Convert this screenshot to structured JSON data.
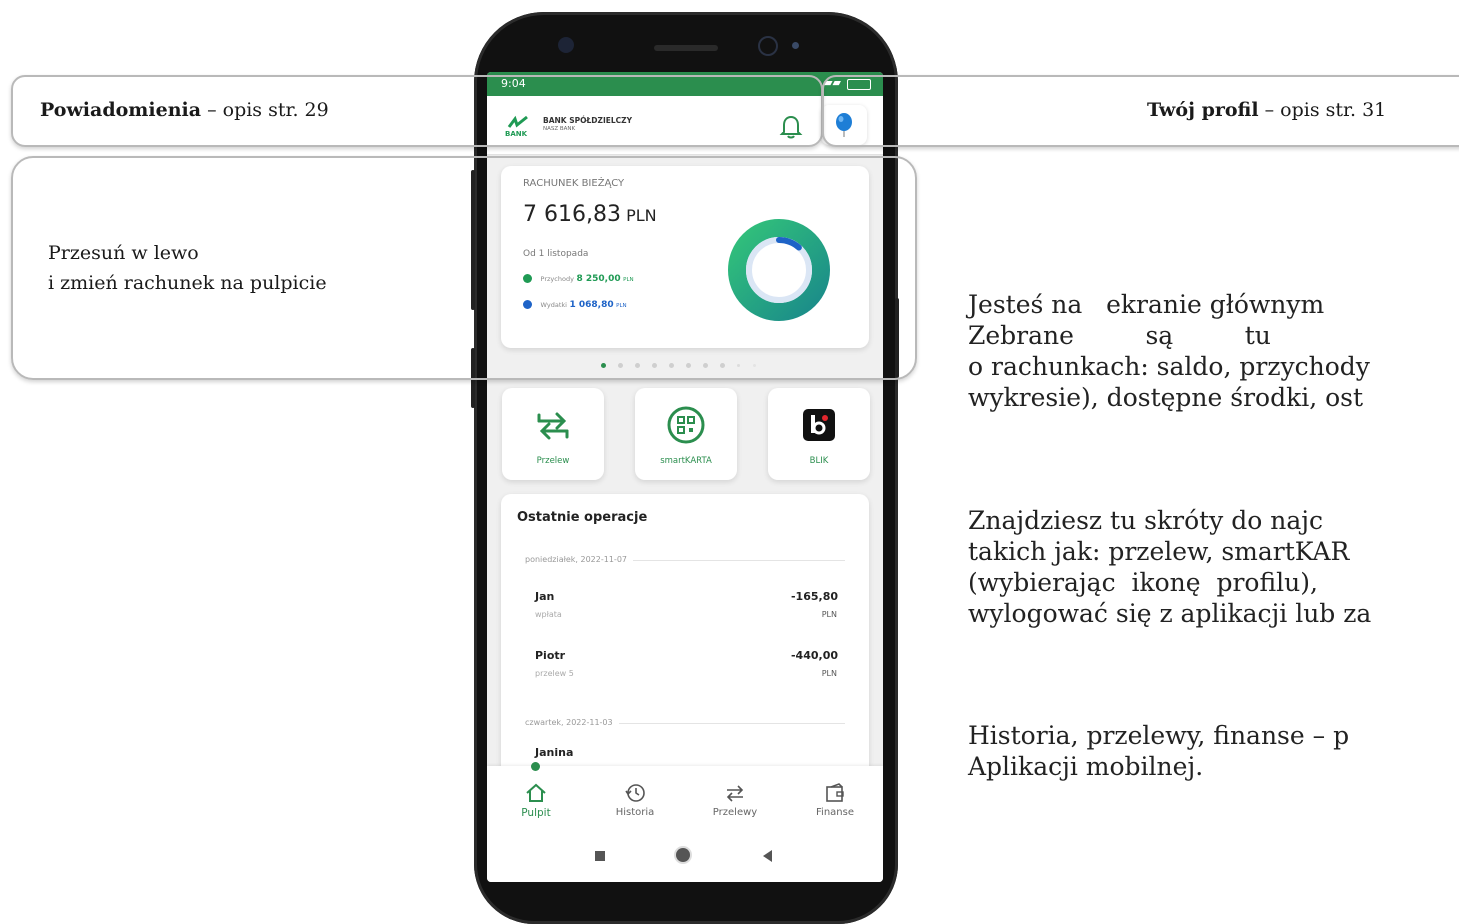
{
  "callouts": {
    "notifications": {
      "bold": "Powiadomienia",
      "rest": " – opis str. 29"
    },
    "profile": {
      "bold": "Twój profil",
      "rest": " – opis str. 31"
    },
    "swipe_line1": "Przesuń w lewo",
    "swipe_line2": "i zmień rachunek na pulpicie"
  },
  "status_bar": {
    "time": "9:04"
  },
  "app": {
    "bank_name": "BANK SPÓŁDZIELCZY",
    "bank_sub": "NASZ BANK",
    "logo_text": "BANK"
  },
  "account": {
    "title": "RACHUNEK BIEŻĄCY",
    "balance": "7 616,83",
    "currency": "PLN",
    "since": "Od 1 listopada",
    "income_label": "Przychody",
    "income_value": "8 250,00",
    "income_currency": "PLN",
    "expense_label": "Wydatki",
    "expense_value": "1 068,80",
    "expense_currency": "PLN",
    "chart_income_share": 0.885,
    "colors": {
      "income": "#1f9a54",
      "expense": "#1e63c7"
    }
  },
  "shortcuts": [
    {
      "label": "Przelew",
      "icon": "transfer-icon"
    },
    {
      "label": "smartKARTA",
      "icon": "qr-icon"
    },
    {
      "label": "BLIK",
      "icon": "blik-icon"
    }
  ],
  "operations": {
    "title": "Ostatnie operacje",
    "groups": [
      {
        "date": "poniedziałek, 2022-11-07",
        "items": [
          {
            "name": "Jan",
            "desc": "wpłata",
            "amount": "-165,80",
            "currency": "PLN"
          },
          {
            "name": "Piotr",
            "desc": "przelew 5",
            "amount": "-440,00",
            "currency": "PLN"
          }
        ]
      },
      {
        "date": "czwartek, 2022-11-03",
        "items": [
          {
            "name": "Janina"
          }
        ]
      }
    ]
  },
  "bottom_nav": [
    {
      "label": "Pulpit",
      "icon": "home-icon",
      "active": true
    },
    {
      "label": "Historia",
      "icon": "history-icon",
      "active": false
    },
    {
      "label": "Przelewy",
      "icon": "transfer-icon",
      "active": false
    },
    {
      "label": "Finanse",
      "icon": "wallet-icon",
      "active": false
    }
  ],
  "description": {
    "p1_l1": "Jesteś na   ekranie głównym",
    "p1_l2": "Zebrane         są         tu",
    "p1_l3": "o rachunkach: saldo, przychody",
    "p1_l4": "wykresie), dostępne środki, ost",
    "p2_l1": "Znajdziesz tu skróty do najc",
    "p2_l2": "takich jak: przelew, smartKAR",
    "p2_l3": "(wybierając  ikonę  profilu),",
    "p2_l4": "wylogować się z aplikacji lub za",
    "p3_l1": "Historia, przelewy, finanse – p",
    "p3_l2": "Aplikacji mobilnej."
  },
  "accent_color": "#2b8e4e"
}
